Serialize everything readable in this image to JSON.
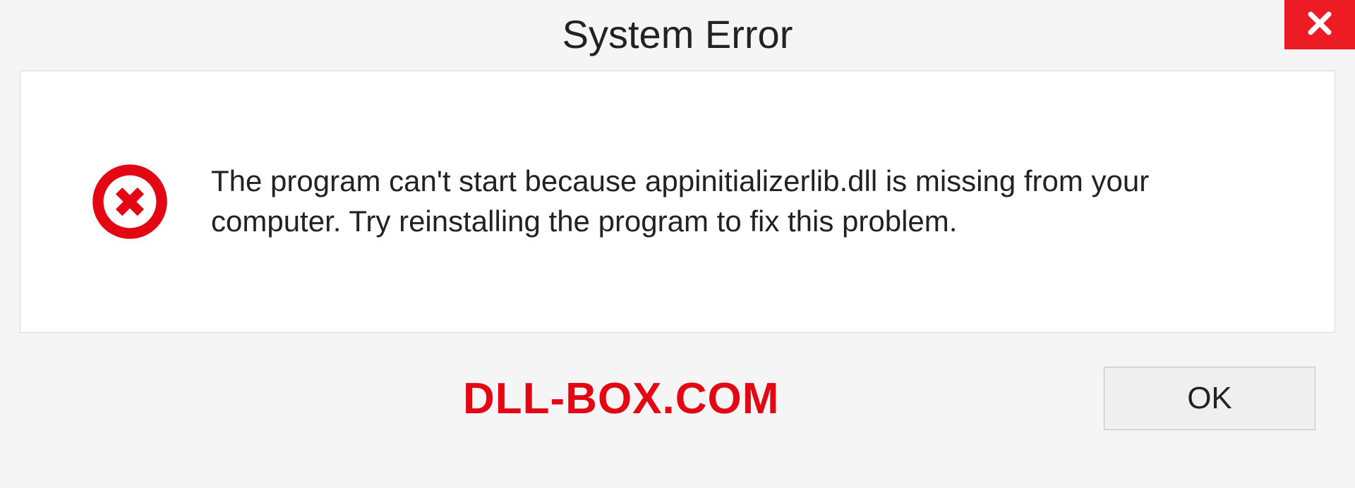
{
  "dialog": {
    "title": "System Error",
    "message": "The program can't start because appinitializerlib.dll is missing from your computer. Try reinstalling the program to fix this problem.",
    "ok_label": "OK"
  },
  "branding": {
    "text": "DLL-BOX.COM"
  },
  "colors": {
    "close_bg": "#ed1c24",
    "error_icon": "#e30613",
    "branding": "#e30613"
  }
}
